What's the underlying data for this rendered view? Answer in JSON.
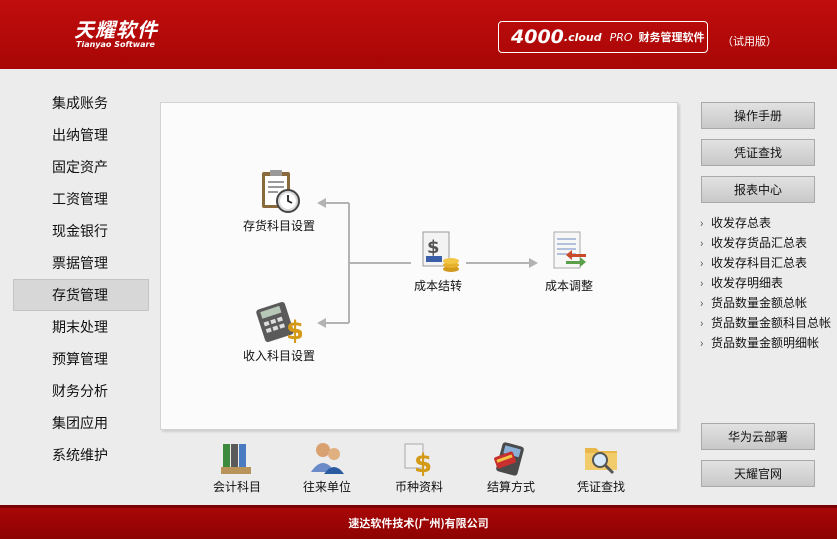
{
  "header": {
    "brand_cn": "天耀软件",
    "brand_en": "Tianyao Software",
    "product_num": "4000",
    "product_cloud": ".cloud",
    "product_pro": "PRO",
    "product_name": "财务管理软件",
    "trial": "（试用版）"
  },
  "nav": {
    "items": [
      {
        "label": "集成账务"
      },
      {
        "label": "出纳管理"
      },
      {
        "label": "固定资产"
      },
      {
        "label": "工资管理"
      },
      {
        "label": "现金银行"
      },
      {
        "label": "票据管理"
      },
      {
        "label": "存货管理",
        "active": true
      },
      {
        "label": "期末处理"
      },
      {
        "label": "预算管理"
      },
      {
        "label": "财务分析"
      },
      {
        "label": "集团应用"
      },
      {
        "label": "系统维护"
      }
    ]
  },
  "flow": {
    "inventory_setup": {
      "label": "存货科目设置",
      "icon": "clipboard-clock-icon"
    },
    "income_setup": {
      "label": "收入科目设置",
      "icon": "calculator-dollar-icon"
    },
    "cost_carry": {
      "label": "成本结转",
      "icon": "invoice-coins-icon"
    },
    "cost_adjust": {
      "label": "成本调整",
      "icon": "document-arrows-icon"
    }
  },
  "toolbar": {
    "items": [
      {
        "label": "会计科目",
        "icon": "binders-icon"
      },
      {
        "label": "往来单位",
        "icon": "users-icon"
      },
      {
        "label": "币种资料",
        "icon": "currency-icon"
      },
      {
        "label": "结算方式",
        "icon": "card-terminal-icon"
      },
      {
        "label": "凭证查找",
        "icon": "folder-search-icon"
      }
    ]
  },
  "right": {
    "manual": "操作手册",
    "voucher_search": "凭证查找",
    "report_center": "报表中心",
    "reports": [
      "收发存总表",
      "收发存货品汇总表",
      "收发存科目汇总表",
      "收发存明细表",
      "货品数量金额总帐",
      "货品数量金额科目总帐",
      "货品数量金额明细帐"
    ],
    "huawei": "华为云部署",
    "official": "天耀官网"
  },
  "footer": {
    "text": "速达软件技术(广州)有限公司"
  },
  "colors": {
    "header": "#b00808",
    "accent": "#a80606",
    "panel": "#ececec"
  }
}
